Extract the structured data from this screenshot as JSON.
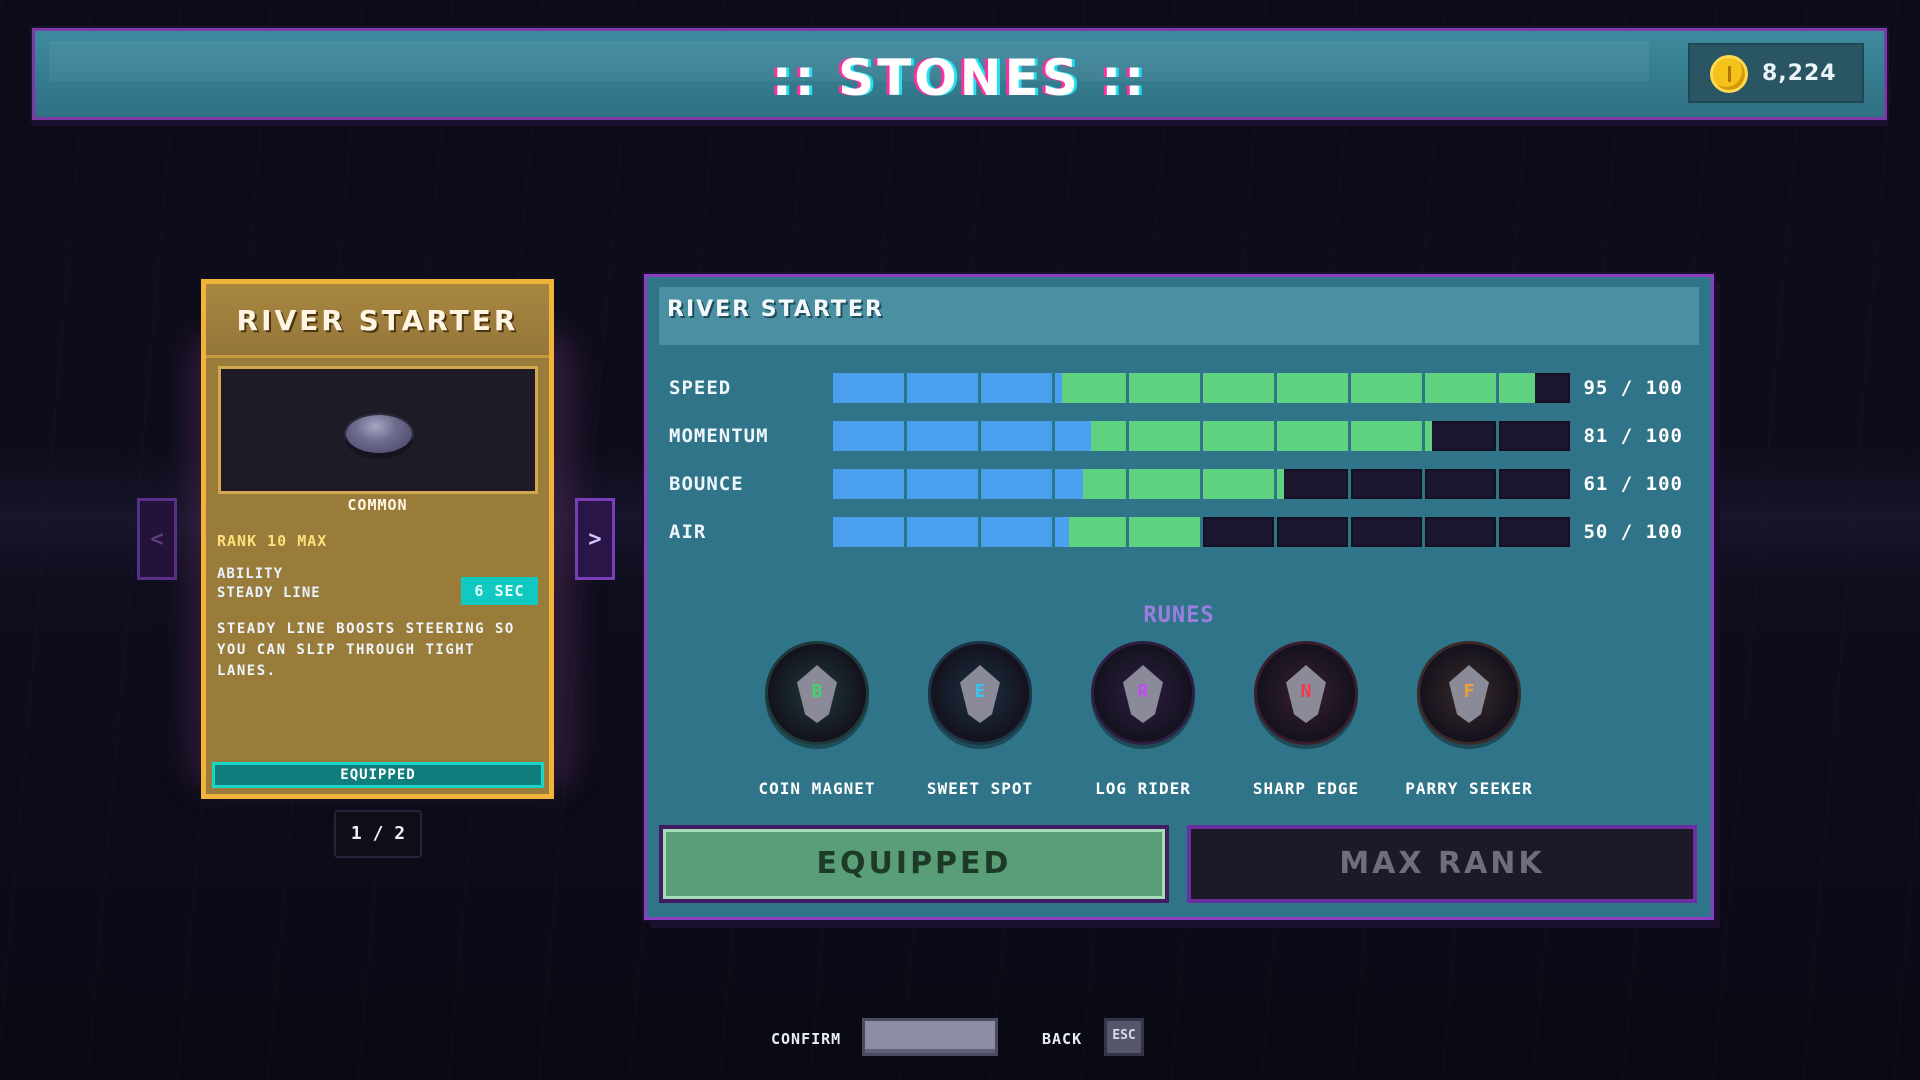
{
  "header": {
    "title": ":: STONES ::",
    "coins": "8,224",
    "coin_icon": "coin-icon"
  },
  "card": {
    "name": "RIVER STARTER",
    "rarity": "COMMON",
    "rank": "RANK 10 MAX",
    "ability_label": "ABILITY",
    "ability_name": "STEADY LINE",
    "cooldown": "6 SEC",
    "description": "STEADY LINE BOOSTS STEERING SO YOU CAN SLIP THROUGH TIGHT LANES.",
    "status": "EQUIPPED",
    "prev_icon": "chevron-left-icon",
    "next_icon": "chevron-right-icon",
    "prev_glyph": "<",
    "next_glyph": ">",
    "page": "1 / 2"
  },
  "panel": {
    "title": "RIVER STARTER",
    "stats": [
      {
        "label": "SPEED",
        "value": 95,
        "max": 100,
        "base": 31,
        "display": "95 / 100"
      },
      {
        "label": "MOMENTUM",
        "value": 81,
        "max": 100,
        "base": 35,
        "display": "81 / 100"
      },
      {
        "label": "BOUNCE",
        "value": 61,
        "max": 100,
        "base": 34,
        "display": "61 / 100"
      },
      {
        "label": "AIR",
        "value": 50,
        "max": 100,
        "base": 32,
        "display": "50 / 100"
      }
    ],
    "runes_title": "RUNES",
    "runes": [
      {
        "name": "COIN MAGNET",
        "glyph": "B",
        "color": "#3fd56a",
        "bg": "#1e3a38"
      },
      {
        "name": "SWEET SPOT",
        "glyph": "E",
        "color": "#38c6f0",
        "bg": "#1b3344"
      },
      {
        "name": "LOG RIDER",
        "glyph": "R",
        "color": "#c04bf0",
        "bg": "#2e1e44"
      },
      {
        "name": "SHARP EDGE",
        "glyph": "N",
        "color": "#f03a4a",
        "bg": "#3a1e2e"
      },
      {
        "name": "PARRY SEEKER",
        "glyph": "F",
        "color": "#f0a030",
        "bg": "#3a2a28"
      }
    ],
    "equip_button": "EQUIPPED",
    "max_rank_button": "MAX RANK"
  },
  "footer": {
    "confirm_label": "CONFIRM",
    "back_label": "BACK",
    "back_key": "ESC"
  },
  "colors": {
    "base_fill": "#4aa0ef",
    "bonus_fill": "#5ed27e",
    "empty": "#1d1630",
    "accent_purple": "#8a3fc0",
    "card_gold": "#f0b43a"
  }
}
